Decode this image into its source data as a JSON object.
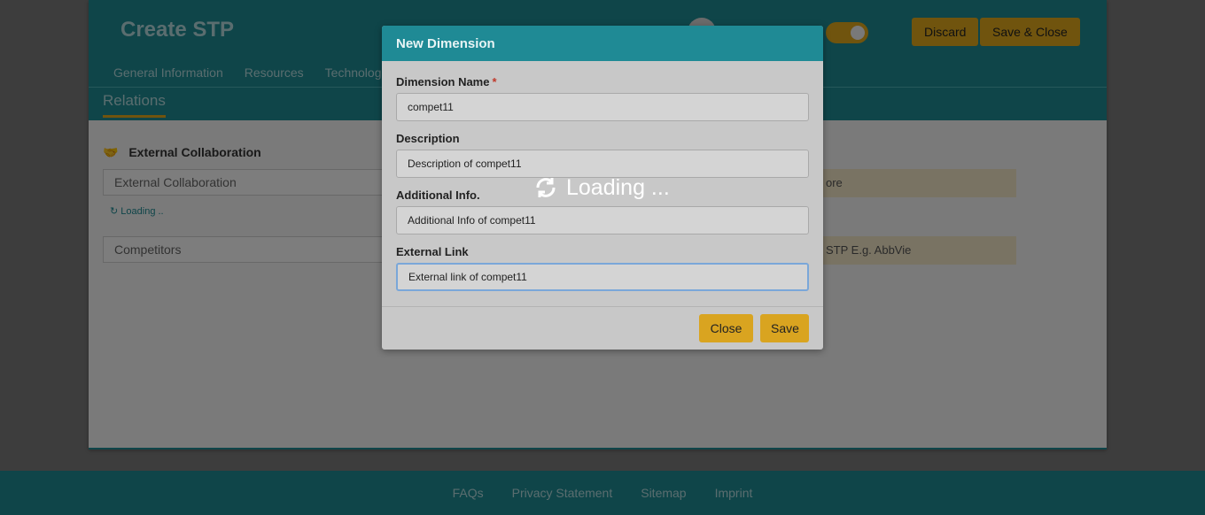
{
  "page": {
    "title": "Create STP",
    "buttons": {
      "discard": "Discard",
      "save_close": "Save & Close"
    },
    "nav_tabs": [
      "General Information",
      "Resources",
      "Technolog"
    ],
    "active_section": "Relations",
    "collab_section": {
      "heading": "External Collaboration",
      "field_placeholder": "External Collaboration",
      "loading_text": "Loading ..",
      "competitors_placeholder": "Competitors",
      "right_hint_1": "ore",
      "right_hint_2": "STP E.g. AbbVie"
    }
  },
  "footer": {
    "links": [
      "FAQs",
      "Privacy Statement",
      "Sitemap",
      "Imprint"
    ]
  },
  "modal": {
    "title": "New Dimension",
    "fields": {
      "name": {
        "label": "Dimension Name",
        "required_mark": "*",
        "value": "compet11"
      },
      "description": {
        "label": "Description",
        "value": "Description of compet11"
      },
      "additional": {
        "label": "Additional Info.",
        "value": "Additional Info of compet11"
      },
      "external": {
        "label": "External Link",
        "value": "External link of compet11"
      }
    },
    "close_label": "Close",
    "save_label": "Save"
  },
  "loading_overlay": "Loading ...",
  "colors": {
    "teal": "#1e8a93",
    "accent": "#e0a81c"
  }
}
